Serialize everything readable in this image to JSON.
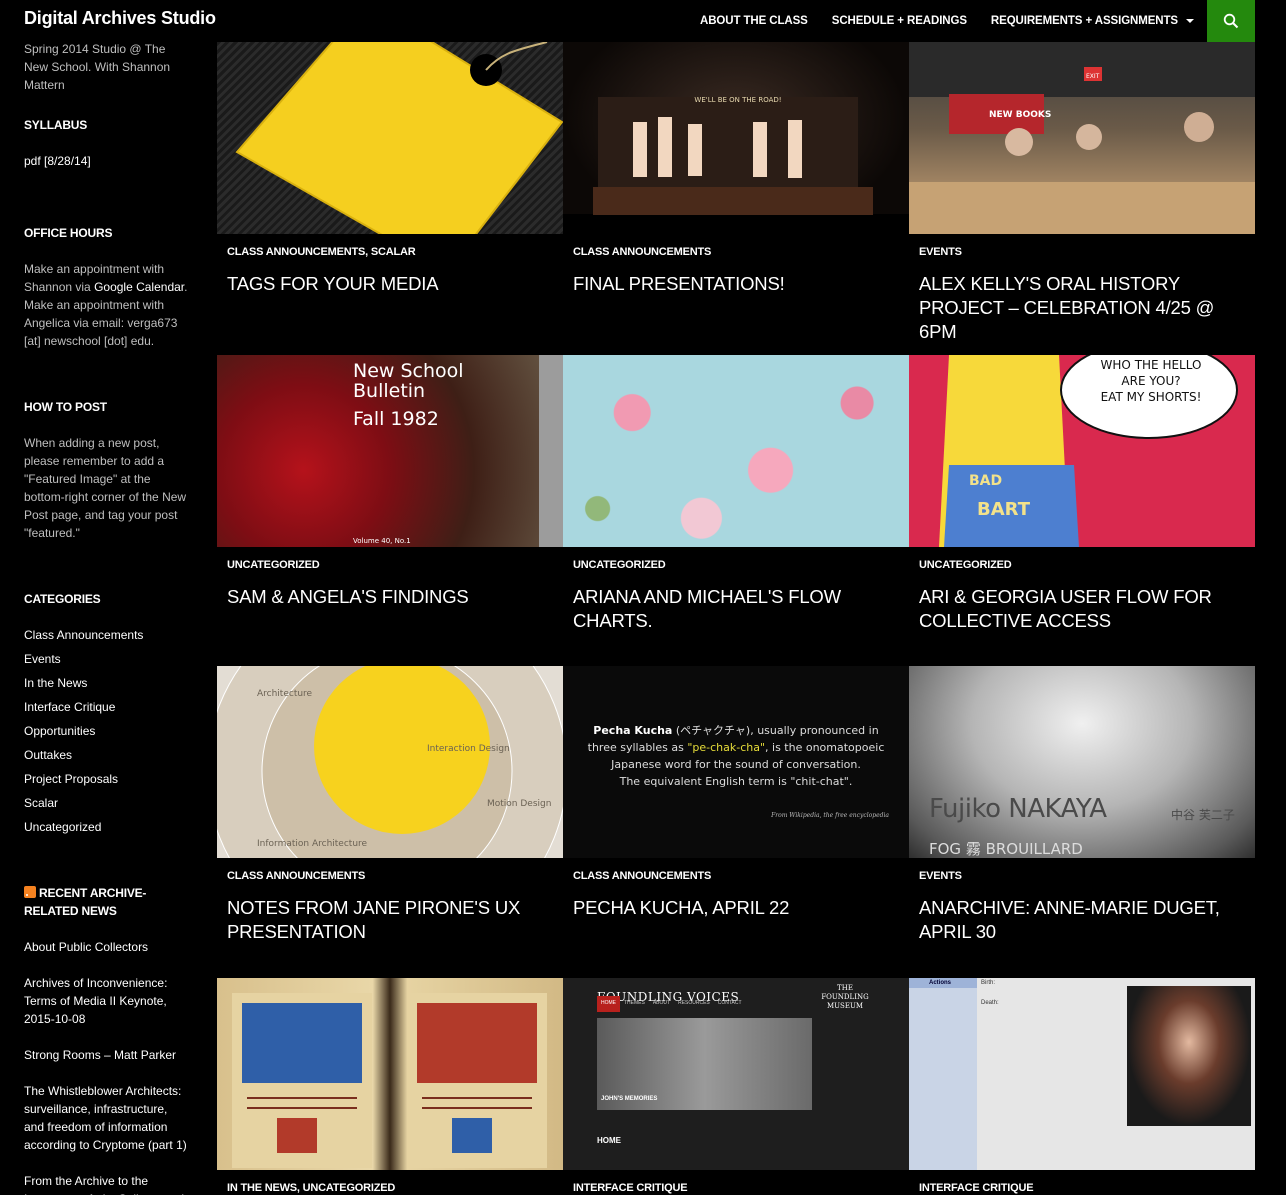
{
  "site": {
    "title": "Digital Archives Studio"
  },
  "nav": {
    "items": [
      "ABOUT THE CLASS",
      "SCHEDULE + READINGS",
      "REQUIREMENTS + ASSIGNMENTS"
    ],
    "search_icon": "search-icon",
    "accent": "#24890d"
  },
  "sidebar": {
    "description": "Spring 2014 Studio @ The New School. With Shannon Mattern",
    "syllabus_title": "SYLLABUS",
    "syllabus_link": "pdf [8/28/14]",
    "office_title": "OFFICE HOURS",
    "office_text_1": "Make an appointment with Shannon via ",
    "office_link": "Google Calendar",
    "office_text_2": ". Make an appointment with Angelica via email: verga673 [at] newschool [dot] edu.",
    "howto_title": "HOW TO POST",
    "howto_text": "When adding a new post, please remember to add a \"Featured Image\" at the bottom-right corner of the New Post page, and tag your post \"featured.\"",
    "categories_title": "CATEGORIES",
    "categories": [
      "Class Announcements",
      "Events",
      "In the News",
      "Interface Critique",
      "Opportunities",
      "Outtakes",
      "Project Proposals",
      "Scalar",
      "Uncategorized"
    ],
    "news_title": "RECENT ARCHIVE-RELATED NEWS",
    "news": [
      "About Public Collectors",
      "Archives of Inconvenience: Terms of Media II Keynote, 2015-10-08",
      "Strong Rooms – Matt Parker",
      "The Whistleblower Architects: surveillance, infrastructure, and freedom of information according to Cryptome (part 1)",
      "From the Archive to the Internet, an Artist Collects and Connects Disparate Images"
    ]
  },
  "posts": [
    {
      "category": "CLASS ANNOUNCEMENTS, SCALAR",
      "title": "TAGS FOR YOUR MEDIA"
    },
    {
      "category": "CLASS ANNOUNCEMENTS",
      "title": "FINAL PRESENTATIONS!",
      "banner": "WE'LL BE ON THE ROAD!"
    },
    {
      "category": "EVENTS",
      "title": "ALEX KELLY'S ORAL HISTORY PROJECT – CELEBRATION 4/25 @ 6PM",
      "sign": "NEW BOOKS",
      "exit": "EXIT"
    },
    {
      "category": "UNCATEGORIZED",
      "title": "SAM & ANGELA'S FINDINGS",
      "cover": [
        "New School",
        "Bulletin",
        "Fall 1982"
      ],
      "volume": "Volume 40, No.1"
    },
    {
      "category": "UNCATEGORIZED",
      "title": "ARIANA AND MICHAEL'S FLOW CHARTS."
    },
    {
      "category": "UNCATEGORIZED",
      "title": "ARI & GEORGIA USER FLOW FOR COLLECTIVE ACCESS",
      "bubble": [
        "WHO THE HELLO",
        "ARE YOU?",
        "EAT MY SHORTS!"
      ],
      "shirt": [
        "BAD",
        "BART"
      ]
    },
    {
      "category": "CLASS ANNOUNCEMENTS",
      "title": "NOTES FROM JANE PIRONE'S UX PRESENTATION",
      "venn": [
        "Architecture",
        "Interaction Design",
        "Motion Design",
        "Information Architecture"
      ]
    },
    {
      "category": "CLASS ANNOUNCEMENTS",
      "title": "PECHA KUCHA, APRIL 22",
      "quote_term": "Pecha Kucha",
      "quote_jp": " (ペチャクチャ), usually pronounced in",
      "quote_l2a": "three syllables as ",
      "quote_l2b": "\"pe-chak-cha\"",
      "quote_l2c": ", is the onomatopoeic",
      "quote_l3": "Japanese word for the sound of conversation.",
      "quote_l4": "The equivalent English term is \"chit-chat\".",
      "source": "From Wikipedia, the free encyclopedia"
    },
    {
      "category": "EVENTS",
      "title": "ANARCHIVE: ANNE-MARIE DUGET, APRIL 30",
      "artist": "Fujiko NAKAYA",
      "artist_jp": "中谷 芙二子",
      "fog": "FOG 霧 BROUILLARD"
    },
    {
      "category": "IN THE NEWS, UNCATEGORIZED",
      "title": ""
    },
    {
      "category": "INTERFACE CRITIQUE",
      "title": "",
      "brand": "FOUNDLING VOICES",
      "museum": "THE FOUNDLING MUSEUM",
      "caption": "JOHN'S MEMORIES",
      "home": "HOME",
      "tabs": [
        "HOME",
        "THEMES",
        "ABOUT",
        "RESOURCES",
        "CONTACT"
      ]
    },
    {
      "category": "INTERFACE CRITIQUE",
      "title": "",
      "actions": "Actions",
      "death_label": "Death:",
      "birth_label": "Birth:"
    }
  ]
}
